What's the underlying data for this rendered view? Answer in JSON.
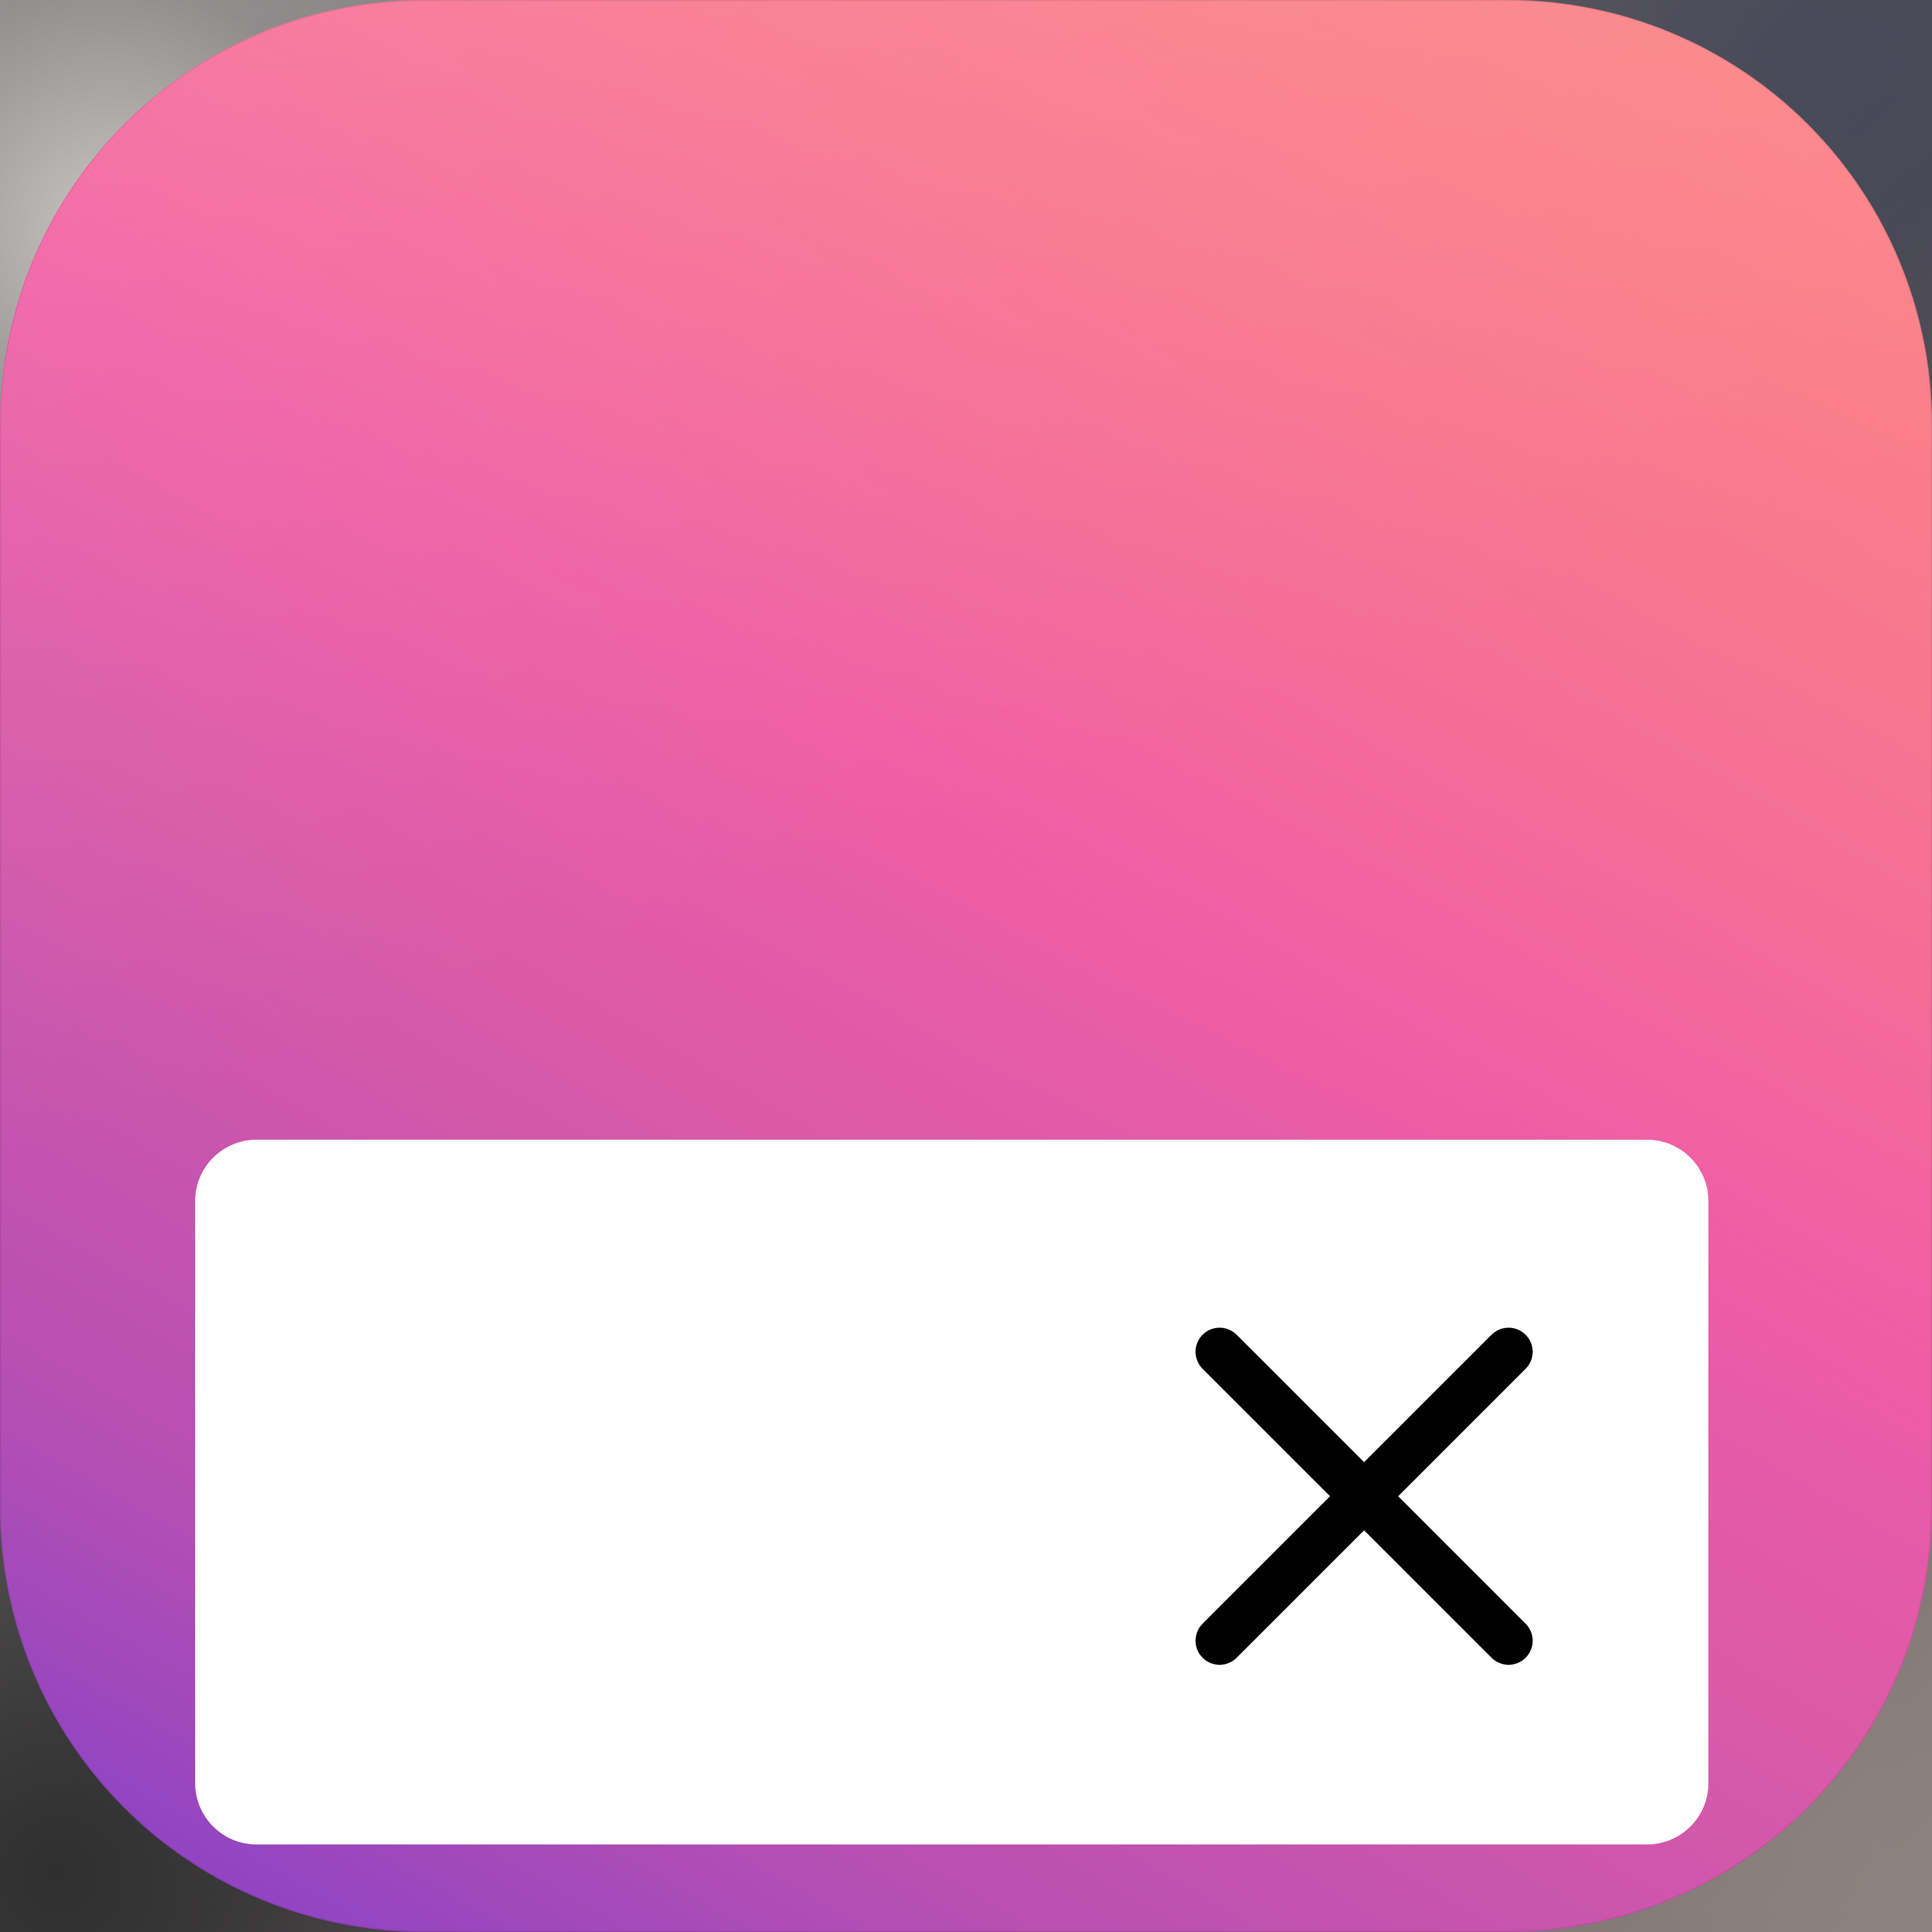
{
  "app_icon": {
    "name": "app icon",
    "gradient_colors": [
      "#7f3fc9",
      "#d95aa8",
      "#ee5aa8",
      "#f8848a"
    ]
  },
  "dismiss_card": {
    "background": "#ffffff"
  },
  "close_button": {
    "icon": "close-icon",
    "color": "#000000"
  }
}
